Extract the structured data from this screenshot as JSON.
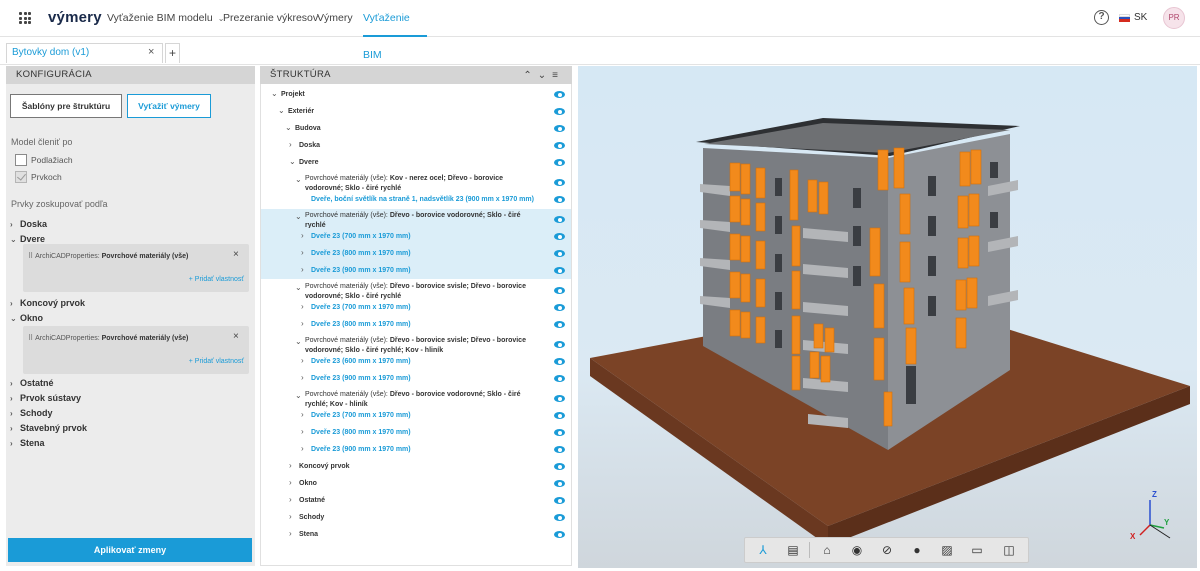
{
  "brand": "výmery",
  "nav": {
    "items": [
      {
        "label": "Vyťaženie BIM modelu",
        "has_caret": true
      },
      {
        "label": "Prezeranie výkresov"
      },
      {
        "label": "Výmery"
      },
      {
        "label": "Vyťaženie BIM"
      }
    ],
    "help_icon": "?",
    "lang": "SK",
    "avatar": "PR"
  },
  "tabs": {
    "open": "Bytovky dom (v1)",
    "close": "×",
    "add": "+"
  },
  "config": {
    "title": "KONFIGURÁCIA",
    "templates_btn": "Šablóny pre štruktúru",
    "extract_btn": "Vyťažiť výmery",
    "split_label": "Model členiť po",
    "split_options": [
      {
        "label": "Podlažiach",
        "checked": false
      },
      {
        "label": "Prvkoch",
        "checked": true
      }
    ],
    "group_label": "Prvky zoskupovať podľa",
    "groups": [
      "Doska",
      "Dvere",
      "Koncový prvok",
      "Okno",
      "Ostatné",
      "Prvok sústavy",
      "Schody",
      "Stavebný prvok",
      "Stena"
    ],
    "expanded": {
      "Dvere": {
        "prop_prefix": "ArchiCADProperties: ",
        "prop_value": "Povrchové materiály (vše)",
        "add": "+ Pridať vlastnosť"
      },
      "Okno": {
        "prop_prefix": "ArchiCADProperties: ",
        "prop_value": "Povrchové materiály (vše)",
        "add": "+ Pridať vlastnosť"
      }
    },
    "apply_btn": "Aplikovať zmeny"
  },
  "structure": {
    "title": "ŠTRUKTÚRA",
    "tree": [
      {
        "text": "Projekt",
        "depth": 0,
        "arrow": "v"
      },
      {
        "text": "Exteriér",
        "depth": 1,
        "arrow": "v"
      },
      {
        "text": "Budova",
        "depth": 2,
        "arrow": "v"
      },
      {
        "text": "Doska",
        "depth": 3,
        "arrow": ">"
      },
      {
        "text": "Dvere",
        "depth": 3,
        "arrow": "v"
      },
      {
        "prefix": "Povrchové materiály (vše): ",
        "text": "Kov - nerez ocel; Dřevo - borovice",
        "line2": "vodorovné; Sklo - čiré rychlé",
        "depth": 4,
        "arrow": "v"
      },
      {
        "text": "Dveře, boční světlík na straně 1, nadsvětlík 23 (900 mm x 1970 mm)",
        "depth": 5,
        "arrow": "",
        "leaf": true
      },
      {
        "prefix": "Povrchové materiály (vše): ",
        "text": "Dřevo - borovice vodorovné; Sklo - čiré",
        "line2": "rychlé",
        "depth": 4,
        "arrow": "v",
        "selected": true
      },
      {
        "text": "Dveře 23 (700 mm x 1970 mm)",
        "depth": 5,
        "arrow": ">",
        "leaf": true,
        "selected": true
      },
      {
        "text": "Dveře 23 (800 mm x 1970 mm)",
        "depth": 5,
        "arrow": ">",
        "leaf": true,
        "selected": true
      },
      {
        "text": "Dveře 23 (900 mm x 1970 mm)",
        "depth": 5,
        "arrow": ">",
        "leaf": true,
        "selected": true
      },
      {
        "prefix": "Povrchové materiály (vše): ",
        "text": "Dřevo - borovice svisle; Dřevo - borovice",
        "line2": "vodorovné; Sklo - čiré rychlé",
        "depth": 4,
        "arrow": "v"
      },
      {
        "text": "Dveře 23 (700 mm x 1970 mm)",
        "depth": 5,
        "arrow": ">",
        "leaf": true
      },
      {
        "text": "Dveře 23 (800 mm x 1970 mm)",
        "depth": 5,
        "arrow": ">",
        "leaf": true
      },
      {
        "prefix": "Povrchové materiály (vše): ",
        "text": "Dřevo - borovice svisle; Dřevo - borovice",
        "line2": "vodorovné; Sklo - čiré rychlé; Kov - hliník",
        "depth": 4,
        "arrow": "v"
      },
      {
        "text": "Dveře 23 (600 mm x 1970 mm)",
        "depth": 5,
        "arrow": ">",
        "leaf": true
      },
      {
        "text": "Dveře 23 (900 mm x 1970 mm)",
        "depth": 5,
        "arrow": ">",
        "leaf": true
      },
      {
        "prefix": "Povrchové materiály (vše): ",
        "text": "Dřevo - borovice vodorovné; Sklo - čiré",
        "line2": "rychlé; Kov - hliník",
        "depth": 4,
        "arrow": "v"
      },
      {
        "text": "Dveře 23 (700 mm x 1970 mm)",
        "depth": 5,
        "arrow": ">",
        "leaf": true
      },
      {
        "text": "Dveře 23 (800 mm x 1970 mm)",
        "depth": 5,
        "arrow": ">",
        "leaf": true
      },
      {
        "text": "Dveře 23 (900 mm x 1970 mm)",
        "depth": 5,
        "arrow": ">",
        "leaf": true
      },
      {
        "text": "Koncový prvok",
        "depth": 3,
        "arrow": ">"
      },
      {
        "text": "Okno",
        "depth": 3,
        "arrow": ">"
      },
      {
        "text": "Ostatné",
        "depth": 3,
        "arrow": ">"
      },
      {
        "text": "Schody",
        "depth": 3,
        "arrow": ">"
      },
      {
        "text": "Stena",
        "depth": 3,
        "arrow": ">"
      }
    ]
  },
  "viewer": {
    "axes": {
      "x": "X",
      "y": "Y",
      "z": "Z"
    },
    "toolbar_icons": [
      "tree-icon",
      "list-icon",
      "home-icon",
      "eye-icon",
      "eye-off-icon",
      "focus-icon",
      "section-icon",
      "ruler-icon",
      "split-icon"
    ]
  },
  "colors": {
    "accent": "#1a9bd7",
    "highlight": "#f28a1c"
  }
}
